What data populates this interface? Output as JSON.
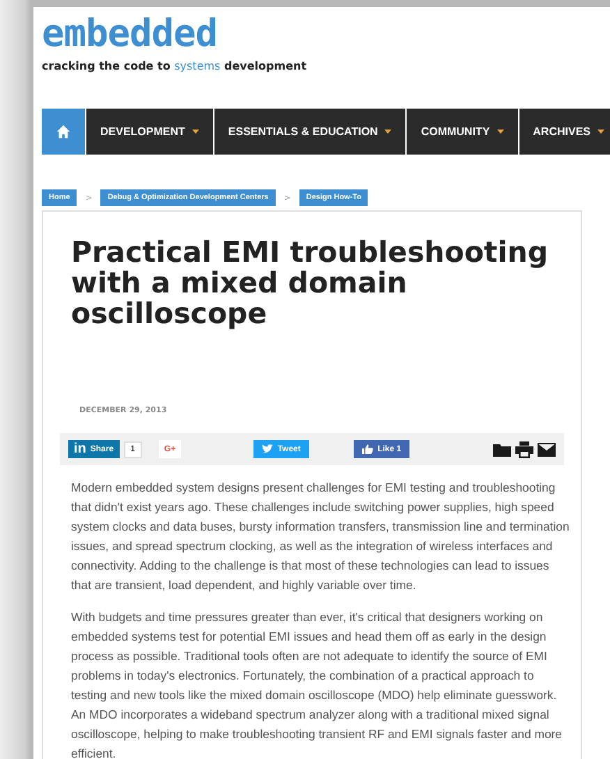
{
  "logo": {
    "text": "embedded"
  },
  "tagline": {
    "before": "cracking the code to",
    "highlight": "systems",
    "after": "development"
  },
  "nav": {
    "items": [
      {
        "label": "DEVELOPMENT"
      },
      {
        "label": "ESSENTIALS & EDUCATION"
      },
      {
        "label": "COMMUNITY"
      },
      {
        "label": "ARCHIVES"
      }
    ]
  },
  "breadcrumbs": [
    "Home",
    "Debug & Optimization Development Centers",
    "Design How-To"
  ],
  "breadcrumb_separator": ">",
  "article": {
    "title": "Practical EMI troubleshooting with a mixed domain oscilloscope",
    "date": "DECEMBER 29, 2013",
    "share": {
      "linkedin_mark": "in",
      "linkedin_label": "Share",
      "linkedin_count": "1",
      "google_label": "G+",
      "tweet_label": "Tweet",
      "like_label": "Like 1"
    },
    "paragraphs": [
      "Modern embedded system designs present challenges for EMI testing and troubleshooting that didn't exist years ago. These challenges include switching power supplies, high speed system clocks and data buses, bursty information transfers, transmission line and termination issues, and spread spectrum clocking, as well as the integration of wireless interfaces and connectivity. Adding to the challenge is that most of these technologies can lead to issues that are transient, load dependent, and highly variable over time.",
      "With budgets and time pressures greater than ever, it's critical that designers working on embedded systems test for potential EMI issues and head them off as early in the design process as possible. Traditional tools often are not adequate to identify the source of EMI problems in today's electronics. Fortunately, the combination of a practical approach to testing and new tools like the mixed domain oscilloscope (MDO) help eliminate guesswork. An MDO incorporates a wideband spectrum analyzer along with a traditional mixed signal oscilloscope, helping to make troubleshooting transient RF and EMI signals faster and more efficient."
    ]
  }
}
